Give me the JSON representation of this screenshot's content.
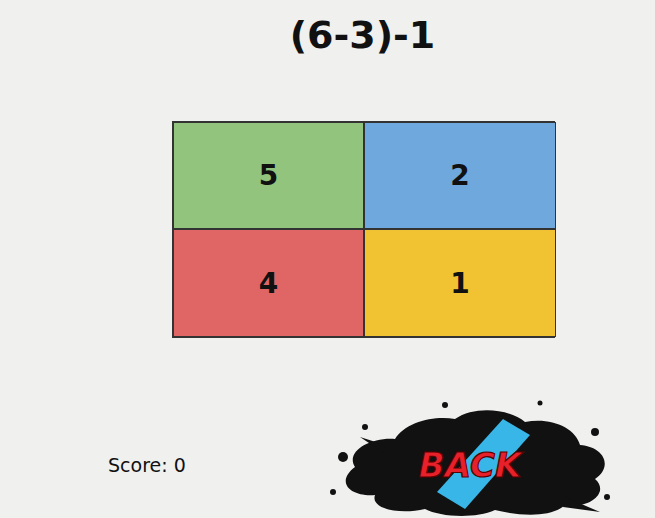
{
  "question": "(6-3)-1",
  "answers": [
    {
      "label": "5",
      "color": "#93c47d"
    },
    {
      "label": "2",
      "color": "#6fa8dc"
    },
    {
      "label": "4",
      "color": "#e06666"
    },
    {
      "label": "1",
      "color": "#f1c232"
    }
  ],
  "score": "Score: 0",
  "back_button": {
    "label": "BACK"
  }
}
